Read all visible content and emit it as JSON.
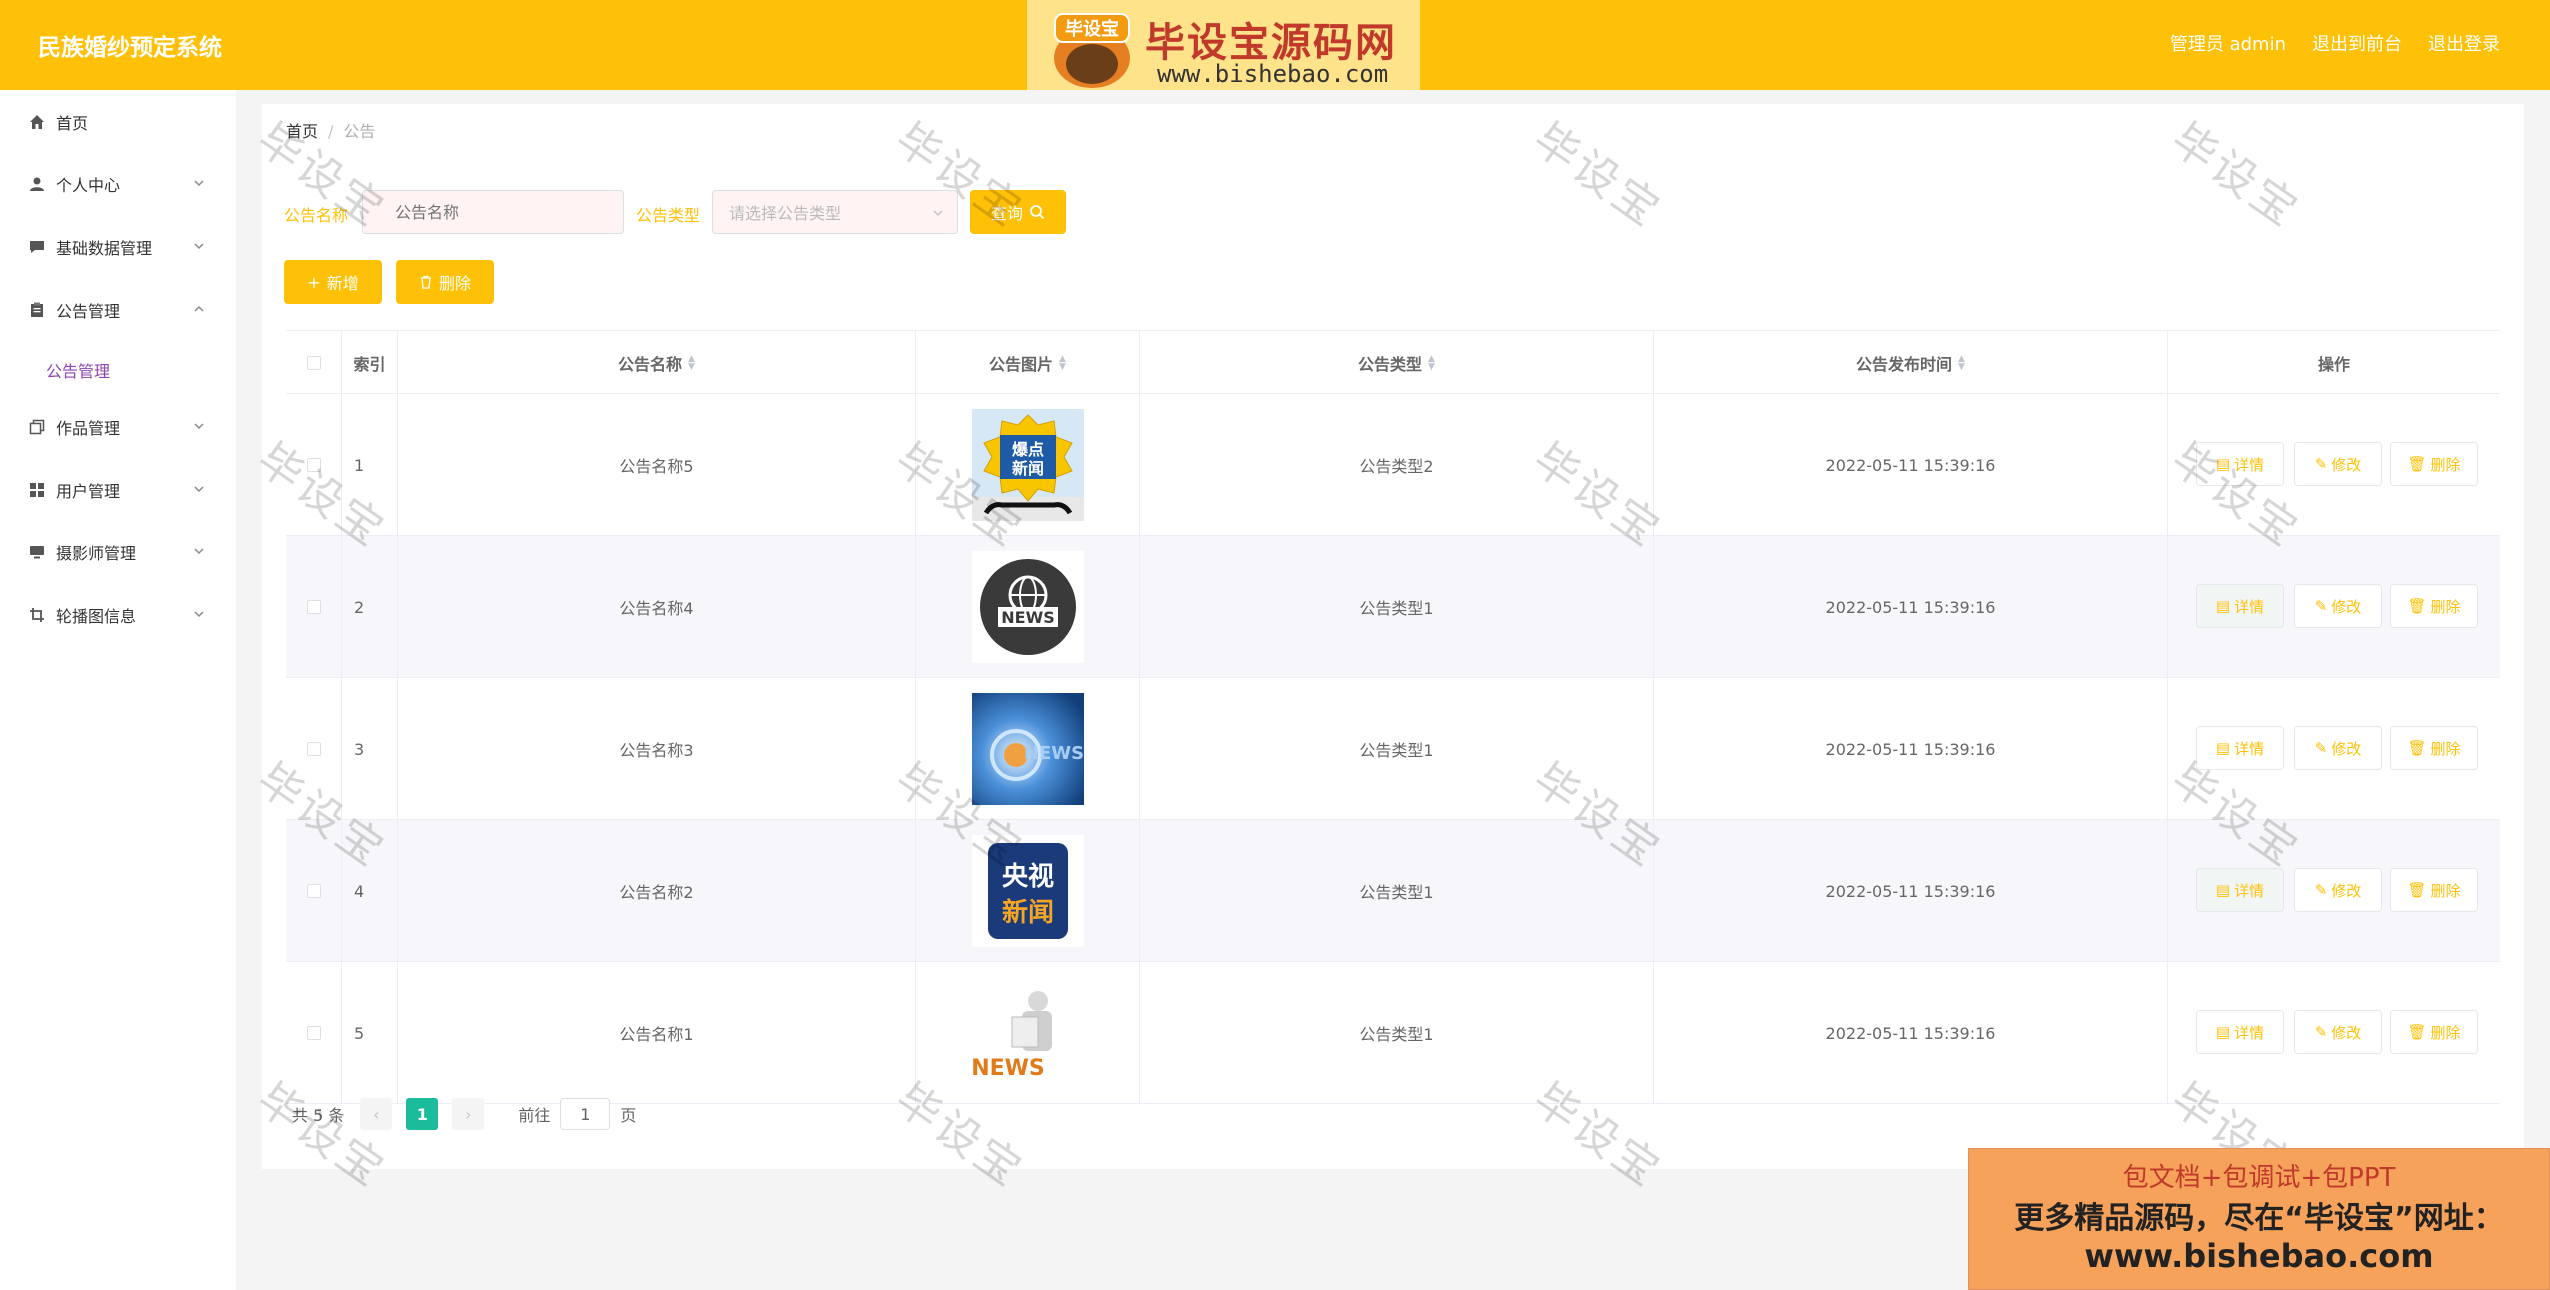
{
  "header": {
    "title": "民族婚纱预定系统",
    "admin_label": "管理员 admin",
    "exit_front": "退出到前台",
    "logout": "退出登录"
  },
  "brand": {
    "badge": "毕设宝",
    "name": "毕设宝源码网",
    "url": "www.bishebao.com"
  },
  "sidebar": {
    "items": [
      {
        "label": "首页",
        "icon": "home-icon"
      },
      {
        "label": "个人中心",
        "icon": "user-icon"
      },
      {
        "label": "基础数据管理",
        "icon": "chat-icon"
      },
      {
        "label": "公告管理",
        "icon": "clipboard-icon"
      },
      {
        "label": "作品管理",
        "icon": "copy-icon"
      },
      {
        "label": "用户管理",
        "icon": "grid-icon"
      },
      {
        "label": "摄影师管理",
        "icon": "monitor-icon"
      },
      {
        "label": "轮播图信息",
        "icon": "crop-icon"
      }
    ],
    "sub_item": "公告管理"
  },
  "breadcrumb": {
    "home": "首页",
    "current": "公告"
  },
  "search": {
    "name_label": "公告名称",
    "name_placeholder": "公告名称",
    "type_label": "公告类型",
    "type_placeholder": "请选择公告类型",
    "query_button": "查询"
  },
  "toolbar": {
    "add": "新增",
    "delete": "删除"
  },
  "table": {
    "headers": {
      "index": "索引",
      "name": "公告名称",
      "image": "公告图片",
      "type": "公告类型",
      "time": "公告发布时间",
      "ops": "操作"
    },
    "rows": [
      {
        "index": "1",
        "name": "公告名称5",
        "type": "公告类型2",
        "time": "2022-05-11 15:39:16",
        "image": "breaking-news"
      },
      {
        "index": "2",
        "name": "公告名称4",
        "type": "公告类型1",
        "time": "2022-05-11 15:39:16",
        "image": "news-globe"
      },
      {
        "index": "3",
        "name": "公告名称3",
        "type": "公告类型1",
        "time": "2022-05-11 15:39:16",
        "image": "news-swirl"
      },
      {
        "index": "4",
        "name": "公告名称2",
        "type": "公告类型1",
        "time": "2022-05-11 15:39:16",
        "image": "cctv-news"
      },
      {
        "index": "5",
        "name": "公告名称1",
        "type": "公告类型1",
        "time": "2022-05-11 15:39:16",
        "image": "news-figure"
      }
    ],
    "thumb_text": {
      "breaking": [
        "爆点",
        "新闻"
      ],
      "globe": "NEWS",
      "swirl": "NEWS",
      "cctv": [
        "央视",
        "新闻"
      ],
      "figure": "NEWS"
    },
    "ops": {
      "detail": "详情",
      "edit": "修改",
      "delete": "删除"
    }
  },
  "pagination": {
    "total": "共 5 条",
    "current": "1",
    "goto": "前往",
    "page_value": "1",
    "page_suffix": "页"
  },
  "ad": {
    "line1": "包文档+包调试+包PPT",
    "line2": "更多精品源码，尽在“毕设宝”网址：",
    "line3": "www.bishebao.com"
  },
  "watermark": "毕设宝",
  "colors": {
    "accent": "#ffc107",
    "current_page": "#1abc9c",
    "sub_menu": "#8e44ad"
  }
}
